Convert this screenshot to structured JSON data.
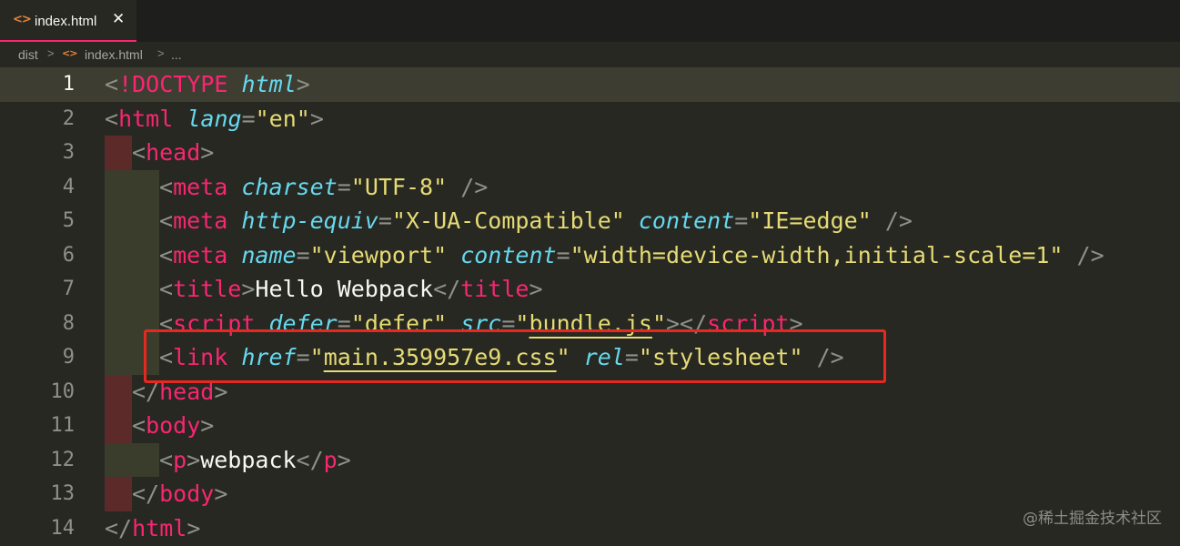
{
  "tab": {
    "icon": "<>",
    "label": "index.html",
    "close": "✕",
    "icon_name": "html-file-icon"
  },
  "breadcrumb": {
    "items": [
      "dist",
      "index.html",
      "..."
    ],
    "separator": ">"
  },
  "editor": {
    "current_line": 1,
    "lines": [
      {
        "num": "1"
      },
      {
        "num": "2"
      },
      {
        "num": "3"
      },
      {
        "num": "4"
      },
      {
        "num": "5"
      },
      {
        "num": "6"
      },
      {
        "num": "7"
      },
      {
        "num": "8"
      },
      {
        "num": "9"
      },
      {
        "num": "10"
      },
      {
        "num": "11"
      },
      {
        "num": "12"
      },
      {
        "num": "13"
      },
      {
        "num": "14"
      }
    ],
    "tokens": {
      "doctype": "!DOCTYPE",
      "html_attr": "html",
      "html": "html",
      "lang": "lang",
      "en": "\"en\"",
      "head": "head",
      "meta": "meta",
      "charset": "charset",
      "utf8": "\"UTF-8\"",
      "http_equiv": "http-equiv",
      "x_ua": "\"X-UA-Compatible\"",
      "content": "content",
      "ie_edge": "\"IE=edge\"",
      "name": "name",
      "viewport": "\"viewport\"",
      "viewport_content": "\"width=device-width,initial-scale=1\"",
      "title": "title",
      "title_text": "Hello Webpack",
      "script": "script",
      "defer": "defer",
      "defer_val": "\"defer\"",
      "src": "src",
      "bundle_q": "\"",
      "bundle": "bundle.js",
      "link": "link",
      "href": "href",
      "main_css": "main.359957e9.css",
      "rel": "rel",
      "stylesheet": "\"stylesheet\"",
      "body": "body",
      "p": "p",
      "p_text": "webpack"
    }
  },
  "watermark": "@稀土掘金技术社区",
  "colors": {
    "background": "#272822",
    "tag": "#f92672",
    "attribute": "#66d9ef",
    "string": "#e6db74",
    "annotation_box": "#e8281f"
  }
}
